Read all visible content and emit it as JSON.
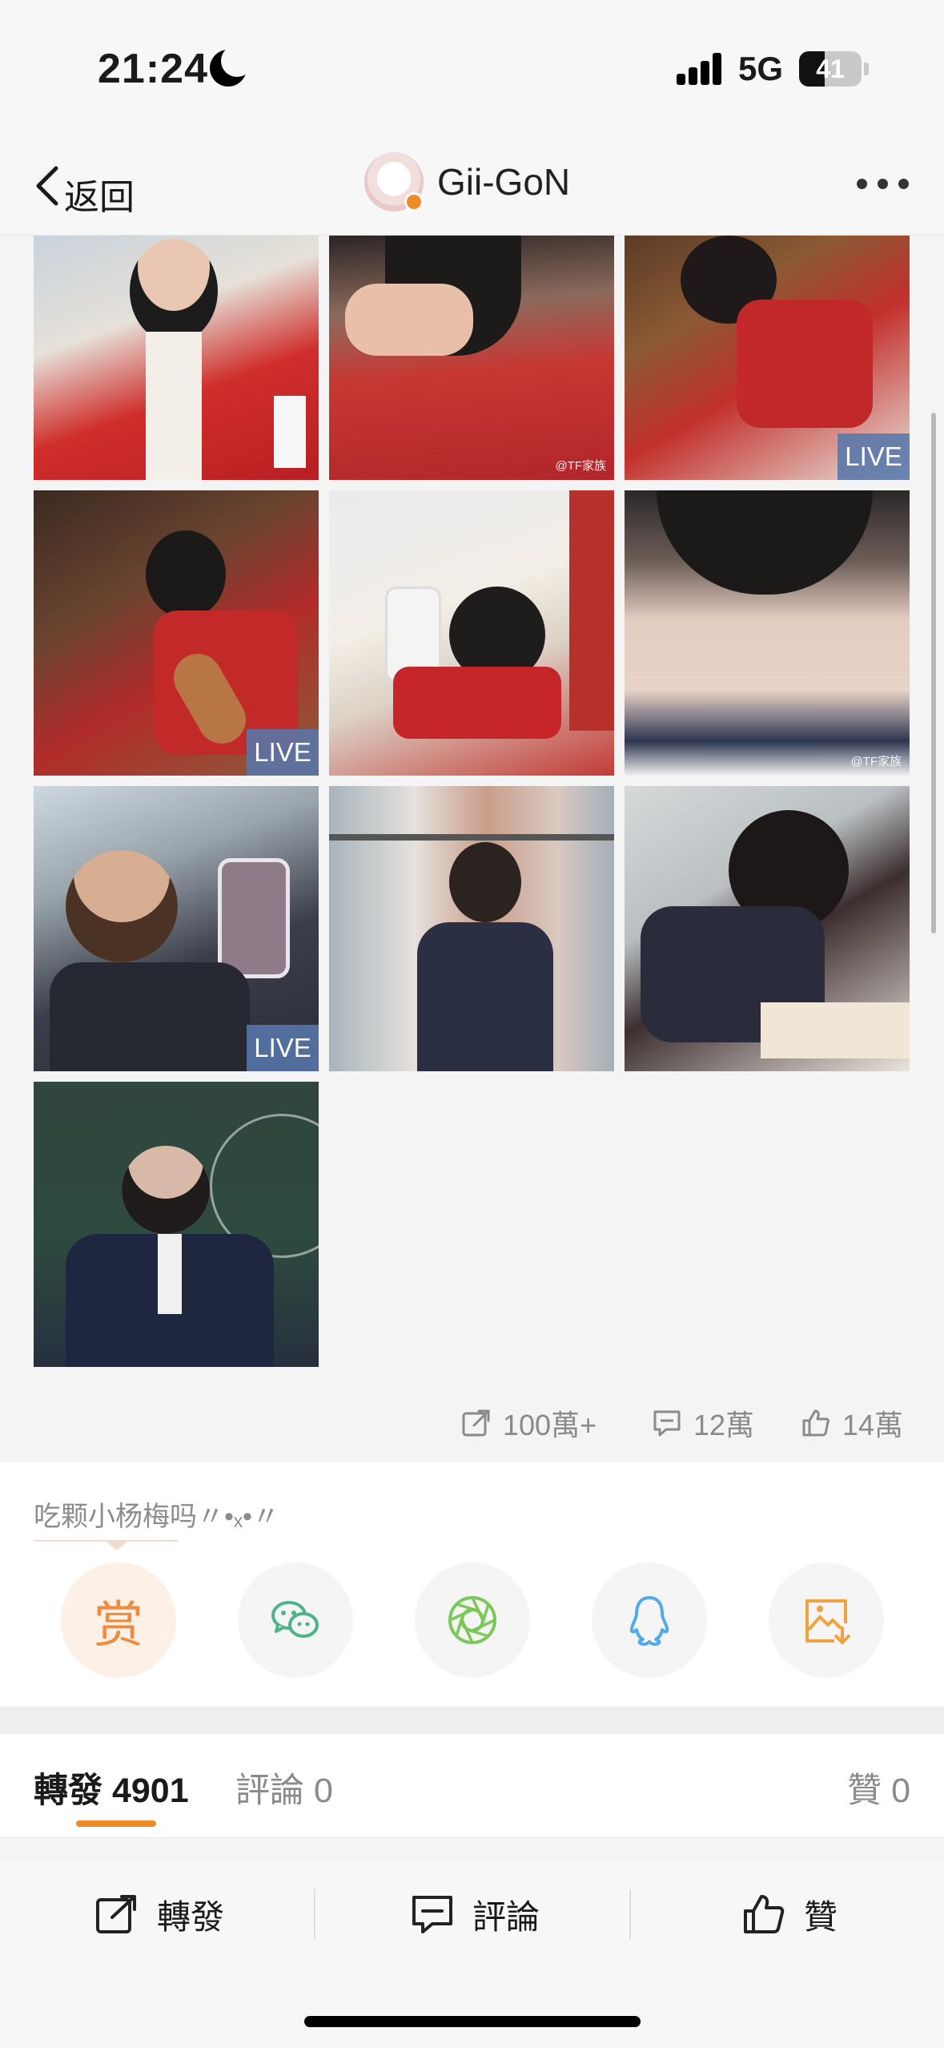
{
  "status_bar": {
    "time": "21:24",
    "network": "5G",
    "battery": "41",
    "battery_level": 0.41
  },
  "nav": {
    "back_label": "返回",
    "title": "Gii-GoN"
  },
  "photos": [
    {
      "name": "photo-1",
      "live": "",
      "watermark": ""
    },
    {
      "name": "photo-2",
      "live": "",
      "watermark": "@TF家族"
    },
    {
      "name": "photo-3",
      "live": "LIVE",
      "watermark": ""
    },
    {
      "name": "photo-4",
      "live": "LIVE",
      "watermark": ""
    },
    {
      "name": "photo-5",
      "live": "",
      "watermark": ""
    },
    {
      "name": "photo-6",
      "live": "",
      "watermark": "@TF家族"
    },
    {
      "name": "photo-7",
      "live": "LIVE",
      "watermark": ""
    },
    {
      "name": "photo-8",
      "live": "",
      "watermark": ""
    },
    {
      "name": "photo-9",
      "live": "",
      "watermark": ""
    },
    {
      "name": "photo-10",
      "live": "",
      "watermark": ""
    }
  ],
  "stats": {
    "reposts": "100萬+",
    "comments": "12萬",
    "likes": "14萬"
  },
  "share": {
    "caption": "吃颗小杨梅吗〃•ₓ•〃",
    "reward_label": "赏",
    "icons": [
      "reward-icon",
      "wechat-icon",
      "moments-icon",
      "qq-icon",
      "save-image-icon"
    ]
  },
  "tabs": {
    "repost": "轉發 4901",
    "comment": "評論 0",
    "like": "贊 0"
  },
  "actions": {
    "repost": "轉發",
    "comment": "評論",
    "like": "贊"
  },
  "colors": {
    "accent": "#f08a24",
    "wechat": "#4fb389",
    "moments": "#7bc85a",
    "qq": "#54a9e8",
    "save": "#f0a23c",
    "live_badge": "#5876aa"
  }
}
